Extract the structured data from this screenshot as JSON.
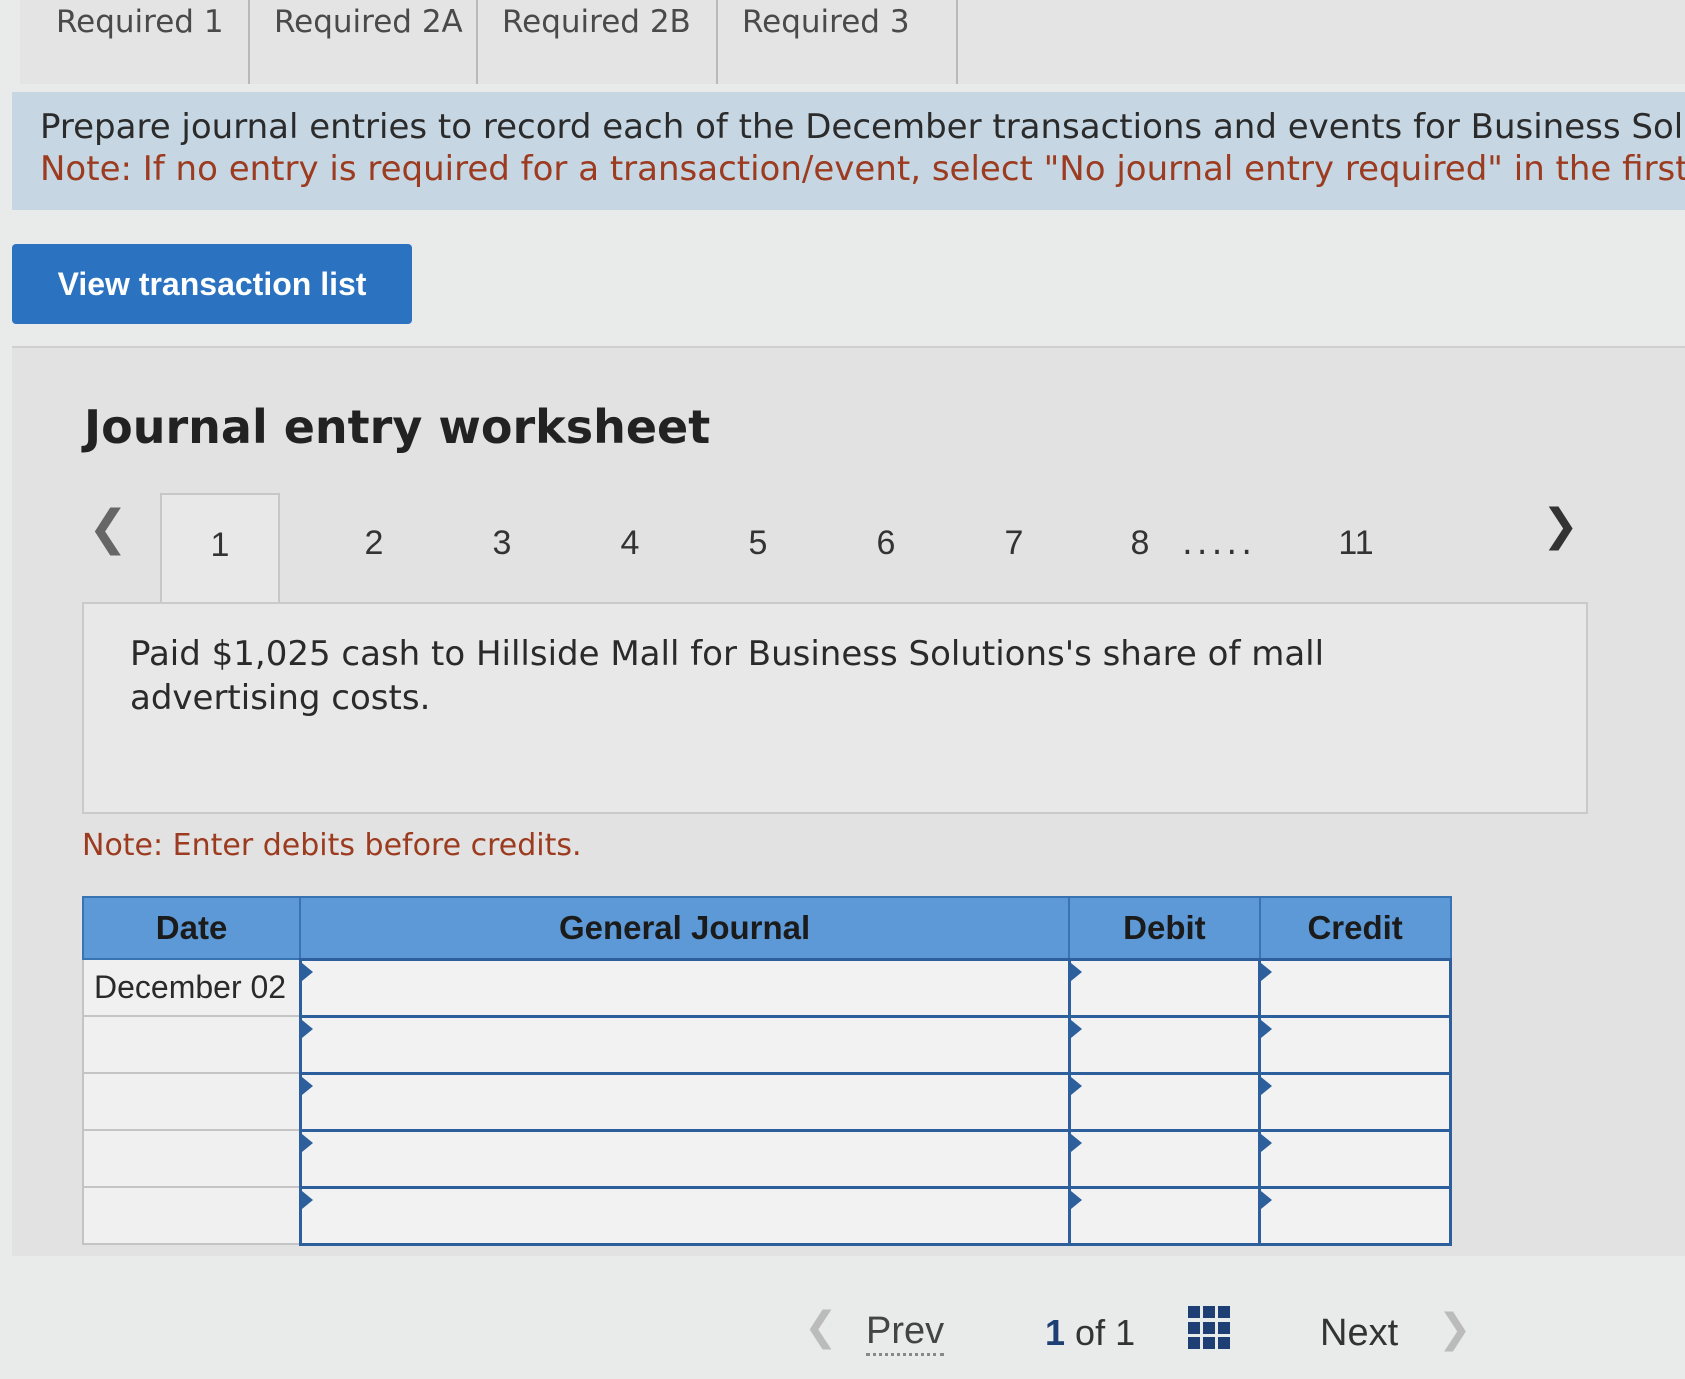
{
  "tabs": [
    "Required 1",
    "Required 2A",
    "Required 2B",
    "Required 3"
  ],
  "instructions": {
    "line1": "Prepare journal entries to record each of the December transactions and events for Business Solutio",
    "line2": "Note: If no entry is required for a transaction/event, select \"No journal entry required\" in the first a"
  },
  "view_button_label": "View transaction list",
  "worksheet": {
    "title": "Journal entry worksheet",
    "nav_tabs": [
      "1",
      "2",
      "3",
      "4",
      "5",
      "6",
      "7",
      "8",
      "11"
    ],
    "dots": ".....",
    "active_tab": "1",
    "description": "Paid $1,025 cash to Hillside Mall for Business Solutions's share of mall advertising costs.",
    "note": "Note: Enter debits before credits."
  },
  "journal": {
    "headers": {
      "date": "Date",
      "general_journal": "General Journal",
      "debit": "Debit",
      "credit": "Credit"
    },
    "rows": [
      {
        "date": "December 02",
        "account": "",
        "debit": "",
        "credit": ""
      },
      {
        "date": "",
        "account": "",
        "debit": "",
        "credit": ""
      },
      {
        "date": "",
        "account": "",
        "debit": "",
        "credit": ""
      },
      {
        "date": "",
        "account": "",
        "debit": "",
        "credit": ""
      },
      {
        "date": "",
        "account": "",
        "debit": "",
        "credit": ""
      }
    ]
  },
  "pager": {
    "prev_label": "Prev",
    "current": "1",
    "of_label": "of",
    "total": "1",
    "next_label": "Next"
  },
  "colors": {
    "header_blue": "#5d99d6",
    "button_blue": "#2b73c1",
    "note_red": "#9c3b1f",
    "instructions_bg": "#c6d7e3"
  },
  "icons": [
    "chevron-left-icon",
    "chevron-right-icon",
    "grid-icon"
  ]
}
